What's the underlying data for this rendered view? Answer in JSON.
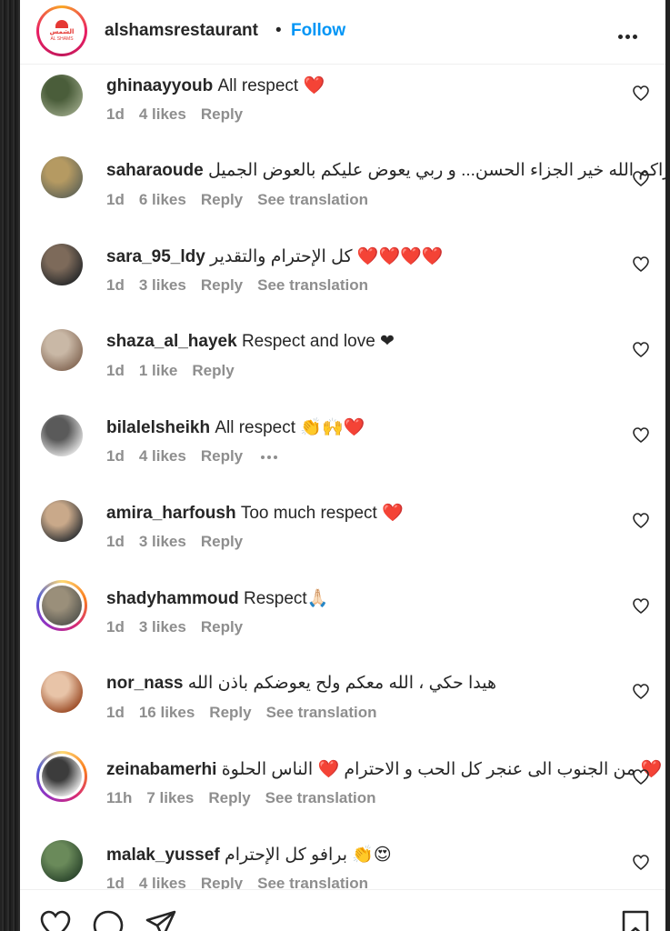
{
  "header": {
    "username": "alshamsrestaurant",
    "separator": "•",
    "follow_label": "Follow",
    "logo_text": "الشمس",
    "logo_sub": "AL SHAMS"
  },
  "comments": [
    {
      "username": "ghinaayyoub",
      "text": "All respect ❤️",
      "time": "1d",
      "likes": "4 likes",
      "reply": "Reply",
      "translation": "",
      "more": false,
      "ring": false,
      "avatar_colors": [
        "#8d9a7a",
        "#4a5d3a"
      ]
    },
    {
      "username": "saharaoude",
      "text": "جزاكم الله خير الجزاء الحسن... و ربي يعوض عليكم بالعوض الجميل",
      "time": "1d",
      "likes": "6 likes",
      "reply": "Reply",
      "translation": "See translation",
      "more": false,
      "ring": false,
      "avatar_colors": [
        "#6b6b58",
        "#b59a62"
      ]
    },
    {
      "username": "sara_95_ldy",
      "text": "❤️❤️❤️❤️ كل الإحترام والتقدير",
      "time": "1d",
      "likes": "3 likes",
      "reply": "Reply",
      "translation": "See translation",
      "more": false,
      "ring": false,
      "avatar_colors": [
        "#2e2e2e",
        "#7d6a5a"
      ]
    },
    {
      "username": "shaza_al_hayek",
      "text": "Respect and love ❤",
      "time": "1d",
      "likes": "1 like",
      "reply": "Reply",
      "translation": "",
      "more": false,
      "ring": false,
      "avatar_colors": [
        "#8a6f5c",
        "#c9b8a6"
      ]
    },
    {
      "username": "bilalelsheikh",
      "text": "All respect 👏🙌❤️",
      "time": "1d",
      "likes": "4 likes",
      "reply": "Reply",
      "translation": "",
      "more": true,
      "ring": false,
      "avatar_colors": [
        "#d9d9d9",
        "#5a5a5a"
      ]
    },
    {
      "username": "amira_harfoush",
      "text": "Too much respect ❤️",
      "time": "1d",
      "likes": "3 likes",
      "reply": "Reply",
      "translation": "",
      "more": false,
      "ring": false,
      "avatar_colors": [
        "#3a3a3a",
        "#c9a98a"
      ]
    },
    {
      "username": "shadyhammoud",
      "text": "Respect🙏🏻",
      "time": "1d",
      "likes": "3 likes",
      "reply": "Reply",
      "translation": "",
      "more": false,
      "ring": true,
      "avatar_colors": [
        "#5b5a52",
        "#9a8f7a"
      ]
    },
    {
      "username": "nor_nass",
      "text": "هيدا حكي ، الله معكم ولح يعوضكم باذن الله",
      "time": "1d",
      "likes": "16 likes",
      "reply": "Reply",
      "translation": "See translation",
      "more": false,
      "ring": false,
      "avatar_colors": [
        "#a0522d",
        "#e8c4a8"
      ]
    },
    {
      "username": "zeinabamerhi",
      "text": "❤️ من الجنوب الى عنجر كل الحب و الاحترام ❤️ الناس الحلوة",
      "time": "11h",
      "likes": "7 likes",
      "reply": "Reply",
      "translation": "See translation",
      "more": false,
      "ring": true,
      "avatar_colors": [
        "#e0e0e0",
        "#3c3c3c"
      ]
    },
    {
      "username": "malak_yussef",
      "text": "😍👏 برافو كل الإحترام",
      "time": "1d",
      "likes": "4 likes",
      "reply": "Reply",
      "translation": "See translation",
      "more": false,
      "ring": false,
      "avatar_colors": [
        "#2f4a2f",
        "#6a8a5a"
      ]
    }
  ]
}
